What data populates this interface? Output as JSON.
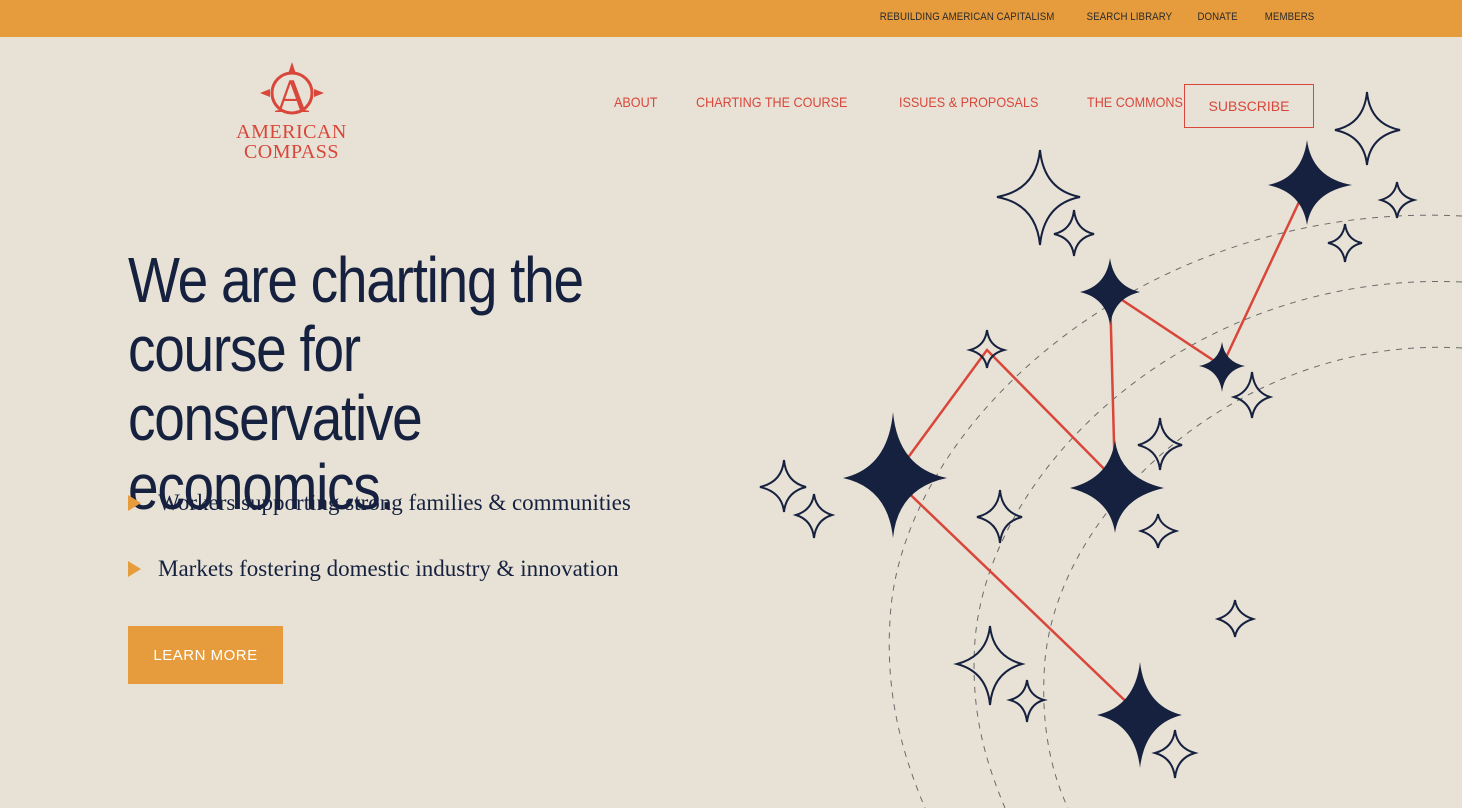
{
  "topbar": {
    "links": [
      "REBUILDING AMERICAN CAPITALISM",
      "SEARCH LIBRARY",
      "DONATE",
      "MEMBERS"
    ]
  },
  "logo": {
    "mark": "A",
    "line1": "AMERICAN",
    "line2": "COMPASS"
  },
  "nav": {
    "items": [
      "ABOUT",
      "CHARTING THE COURSE",
      "ISSUES & PROPOSALS",
      "THE COMMONS"
    ],
    "subscribe_label": "SUBSCRIBE"
  },
  "hero": {
    "title": "We are charting the course for conservative economics.",
    "bullets": [
      "Workers supporting strong families & communities",
      "Markets fostering domestic industry & innovation"
    ],
    "cta_label": "LEARN MORE"
  },
  "colors": {
    "topbar": "#e69c3c",
    "background": "#e8e2d6",
    "accent_red": "#d9463a",
    "navy": "#15213f"
  }
}
